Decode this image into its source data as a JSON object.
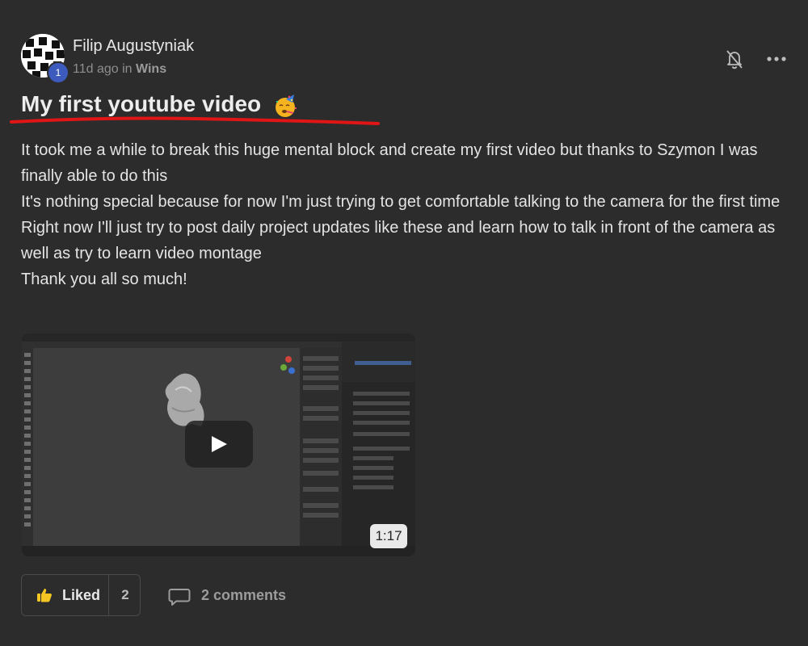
{
  "author": {
    "name": "Filip Augustyniak",
    "level": "1",
    "avatar_icon": "checkered-avatar"
  },
  "meta": {
    "time": "11d ago",
    "in_word": "in",
    "category": "Wins"
  },
  "actions": {
    "bell_icon": "bell-off-icon",
    "more_icon": "more-horizontal-icon"
  },
  "post": {
    "title": "My first youtube video",
    "title_emoji": "partying-face-icon",
    "underline_color": "#e01515",
    "paragraphs": [
      "It took me a while to break this huge mental block and create my first video but thanks to Szymon I was finally able to do this",
      "It's nothing special because for now I'm just trying to get comfortable talking to the camera for the first time",
      "Right now I'll just try to post daily project updates like these and learn how to talk in front of the camera as well as try to learn video montage",
      "Thank you all so much!"
    ]
  },
  "video": {
    "duration": "1:17",
    "play_icon": "play-icon"
  },
  "footer": {
    "like_label": "Liked",
    "like_count": "2",
    "comments_label": "2 comments"
  }
}
